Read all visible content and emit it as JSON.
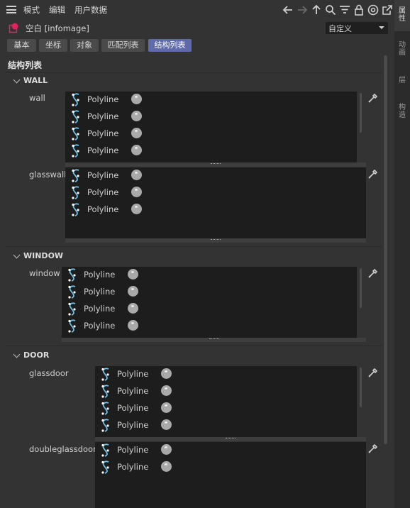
{
  "menubar": {
    "items": [
      "模式",
      "编辑",
      "用户数据"
    ]
  },
  "object": {
    "name": "空白 [infomage]",
    "mode_select": "自定义"
  },
  "tabs": [
    {
      "label": "基本",
      "active": false
    },
    {
      "label": "坐标",
      "active": false
    },
    {
      "label": "对象",
      "active": false
    },
    {
      "label": "匹配列表",
      "active": false
    },
    {
      "label": "结构列表",
      "active": true
    }
  ],
  "section": {
    "title": "结构列表"
  },
  "groups": {
    "wall": {
      "title": "WALL"
    },
    "window": {
      "title": "WINDOW"
    },
    "door": {
      "title": "DOOR"
    }
  },
  "fields": {
    "wall": {
      "label": "wall",
      "items": [
        "Polyline",
        "Polyline",
        "Polyline",
        "Polyline"
      ]
    },
    "glasswall": {
      "label": "glasswall",
      "items": [
        "Polyline",
        "Polyline",
        "Polyline"
      ]
    },
    "window": {
      "label": "window",
      "items": [
        "Polyline",
        "Polyline",
        "Polyline",
        "Polyline"
      ]
    },
    "glassdoor": {
      "label": "glassdoor",
      "items": [
        "Polyline",
        "Polyline",
        "Polyline",
        "Polyline"
      ]
    },
    "doubleglassdoor": {
      "label": "doubleglassdoor",
      "items": [
        "Polyline",
        "Polyline"
      ]
    }
  },
  "side_tabs": [
    "属性",
    "动画",
    "层",
    "构造"
  ],
  "colors": {
    "accent_tab": "#5e6aa9",
    "spline_icon": "#6bc4e8",
    "object_icon": "#e0245e"
  }
}
